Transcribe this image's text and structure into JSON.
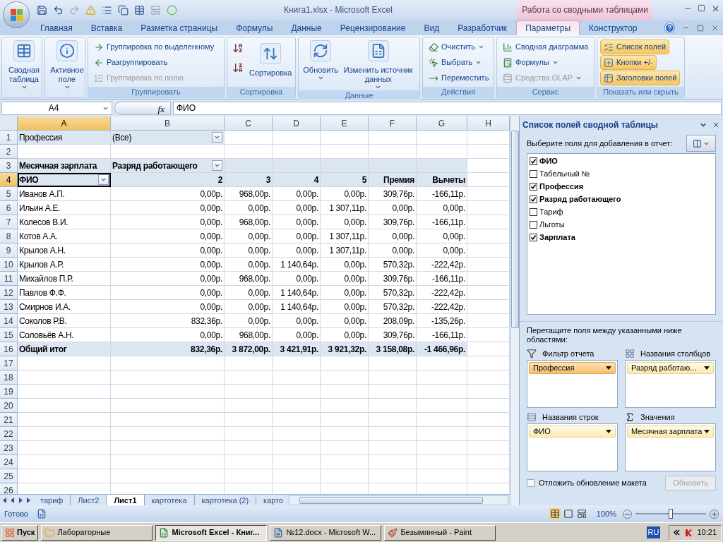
{
  "title_bar": {
    "title": "Книга1.xlsx - Microsoft Excel",
    "context_title": "Работа со сводными таблицами"
  },
  "tabs": [
    {
      "label": "Главная",
      "selected": false
    },
    {
      "label": "Вставка",
      "selected": false
    },
    {
      "label": "Разметка страницы",
      "selected": false
    },
    {
      "label": "Формулы",
      "selected": false
    },
    {
      "label": "Данные",
      "selected": false
    },
    {
      "label": "Рецензирование",
      "selected": false
    },
    {
      "label": "Вид",
      "selected": false
    },
    {
      "label": "Разработчик",
      "selected": false
    },
    {
      "label": "Параметры",
      "selected": true
    },
    {
      "label": "Конструктор",
      "selected": false
    }
  ],
  "ribbon": [
    {
      "items": [
        {
          "kind": "large",
          "label": "Сводная таблица",
          "dropdown": true,
          "disabled": false
        }
      ]
    },
    {
      "items": [
        {
          "kind": "large",
          "label": "Активное поле",
          "dropdown": true,
          "disabled": false
        }
      ]
    },
    {
      "label": "Группировать",
      "items": [
        {
          "kind": "small",
          "label": "Группировка по выделенному",
          "dropdown": false,
          "disabled": false
        },
        {
          "kind": "small",
          "label": "Разгруппировать",
          "dropdown": false,
          "disabled": false
        },
        {
          "kind": "small",
          "label": "Группировка по полю",
          "dropdown": false,
          "disabled": true
        }
      ]
    },
    {
      "label": "Сортировка",
      "items": [
        {
          "kind": "icon"
        },
        {
          "kind": "icon"
        },
        {
          "kind": "large",
          "label": "Сортировка",
          "dropdown": false,
          "disabled": false
        }
      ]
    },
    {
      "label": "Данные",
      "items": [
        {
          "kind": "large",
          "label": "Обновить",
          "dropdown": true,
          "disabled": false
        },
        {
          "kind": "large",
          "label": "Изменить источник данных",
          "dropdown": true,
          "disabled": false
        }
      ]
    },
    {
      "label": "Действия",
      "items": [
        {
          "kind": "small",
          "label": "Очистить",
          "dropdown": true,
          "disabled": false
        },
        {
          "kind": "small",
          "label": "Выбрать",
          "dropdown": true,
          "disabled": false
        },
        {
          "kind": "small",
          "label": "Переместить",
          "dropdown": false,
          "disabled": false
        }
      ]
    },
    {
      "label": "Сервис",
      "items": [
        {
          "kind": "small",
          "label": "Сводная диаграмма",
          "dropdown": false,
          "disabled": false
        },
        {
          "kind": "small",
          "label": "Формулы",
          "dropdown": true,
          "disabled": false
        },
        {
          "kind": "small",
          "label": "Средства OLAP",
          "dropdown": true,
          "disabled": true
        }
      ]
    },
    {
      "label": "Показать или скрыть",
      "items": [
        {
          "kind": "toggle",
          "label": "Список полей",
          "on": true
        },
        {
          "kind": "toggle",
          "label": "Кнопки +/-",
          "on": true
        },
        {
          "kind": "toggle",
          "label": "Заголовки полей",
          "on": true
        }
      ]
    }
  ],
  "formula_bar": {
    "name_box": "A4",
    "fx": "fx",
    "formula": "ФИО"
  },
  "columns": [
    {
      "label": "A",
      "selected": true
    },
    {
      "label": "B",
      "selected": false
    },
    {
      "label": "C",
      "selected": false
    },
    {
      "label": "D",
      "selected": false
    },
    {
      "label": "E",
      "selected": false
    },
    {
      "label": "F",
      "selected": false
    },
    {
      "label": "G",
      "selected": false
    },
    {
      "label": "H",
      "selected": false
    }
  ],
  "row_headers": [
    {
      "label": "1",
      "selected": false
    },
    {
      "label": "2",
      "selected": false
    },
    {
      "label": "3",
      "selected": false
    },
    {
      "label": "4",
      "selected": true
    },
    {
      "label": "5",
      "selected": false
    },
    {
      "label": "6",
      "selected": false
    },
    {
      "label": "7",
      "selected": false
    },
    {
      "label": "8",
      "selected": false
    },
    {
      "label": "9",
      "selected": false
    },
    {
      "label": "10",
      "selected": false
    },
    {
      "label": "11",
      "selected": false
    },
    {
      "label": "12",
      "selected": false
    },
    {
      "label": "13",
      "selected": false
    },
    {
      "label": "14",
      "selected": false
    },
    {
      "label": "15",
      "selected": false
    },
    {
      "label": "16",
      "selected": false
    },
    {
      "label": "17",
      "selected": false
    },
    {
      "label": "18",
      "selected": false
    },
    {
      "label": "19",
      "selected": false
    },
    {
      "label": "20",
      "selected": false
    },
    {
      "label": "21",
      "selected": false
    },
    {
      "label": "22",
      "selected": false
    },
    {
      "label": "23",
      "selected": false
    },
    {
      "label": "24",
      "selected": false
    },
    {
      "label": "25",
      "selected": false
    },
    {
      "label": "26",
      "selected": false
    }
  ],
  "pivot": {
    "filter": {
      "label": "Профессия",
      "value": "(Все)"
    },
    "values_label": "Месячная зарплата",
    "column_field": "Разряд работающего",
    "row_field": "ФИО",
    "column_headers": [
      "2",
      "3",
      "4",
      "5",
      "Премия",
      "Вычеты"
    ],
    "rows": [
      {
        "name": "Иванов А.П.",
        "values": [
          "0,00р.",
          "968,00р.",
          "0,00р.",
          "0,00р.",
          "309,76р.",
          "-166,11р."
        ]
      },
      {
        "name": "Ильин А.Е.",
        "values": [
          "0,00р.",
          "0,00р.",
          "0,00р.",
          "1 307,11р.",
          "0,00р.",
          "0,00р."
        ]
      },
      {
        "name": "Колесов В.И.",
        "values": [
          "0,00р.",
          "968,00р.",
          "0,00р.",
          "0,00р.",
          "309,76р.",
          "-166,11р."
        ]
      },
      {
        "name": "Котов А.А.",
        "values": [
          "0,00р.",
          "0,00р.",
          "0,00р.",
          "1 307,11р.",
          "0,00р.",
          "0,00р."
        ]
      },
      {
        "name": "Крылов А.Н.",
        "values": [
          "0,00р.",
          "0,00р.",
          "0,00р.",
          "1 307,11р.",
          "0,00р.",
          "0,00р."
        ]
      },
      {
        "name": "Крылов А.Р.",
        "values": [
          "0,00р.",
          "0,00р.",
          "1 140,64р.",
          "0,00р.",
          "570,32р.",
          "-222,42р."
        ]
      },
      {
        "name": "Михайлов П.Р.",
        "values": [
          "0,00р.",
          "968,00р.",
          "0,00р.",
          "0,00р.",
          "309,76р.",
          "-166,11р."
        ]
      },
      {
        "name": "Павлов Ф.Ф.",
        "values": [
          "0,00р.",
          "0,00р.",
          "1 140,64р.",
          "0,00р.",
          "570,32р.",
          "-222,42р."
        ]
      },
      {
        "name": "Смирнов И.А.",
        "values": [
          "0,00р.",
          "0,00р.",
          "1 140,64р.",
          "0,00р.",
          "570,32р.",
          "-222,42р."
        ]
      },
      {
        "name": "Соколов Р.В.",
        "values": [
          "832,36р.",
          "0,00р.",
          "0,00р.",
          "0,00р.",
          "208,09р.",
          "-135,26р."
        ]
      },
      {
        "name": "Соловьёв А.Н.",
        "values": [
          "0,00р.",
          "968,00р.",
          "0,00р.",
          "0,00р.",
          "309,76р.",
          "-166,11р."
        ]
      }
    ],
    "total": {
      "label": "Общий итог",
      "values": [
        "832,36р.",
        "3 872,00р.",
        "3 421,91р.",
        "3 921,32р.",
        "3 158,08р.",
        "-1 466,96р."
      ]
    }
  },
  "sheet_tabs": [
    {
      "label": "тариф",
      "selected": false
    },
    {
      "label": "Лист2",
      "selected": false
    },
    {
      "label": "Лист1",
      "selected": true
    },
    {
      "label": "картотека",
      "selected": false
    },
    {
      "label": "картотека (2)",
      "selected": false
    },
    {
      "label": "карто",
      "selected": false
    }
  ],
  "field_list": {
    "title": "Список полей сводной таблицы",
    "prompt": "Выберите поля для добавления в отчет:",
    "fields": [
      {
        "label": "ФИО",
        "checked": true
      },
      {
        "label": "Табельный №",
        "checked": false
      },
      {
        "label": "Профессия",
        "checked": true
      },
      {
        "label": "Разряд работающего",
        "checked": true
      },
      {
        "label": "Тариф",
        "checked": false
      },
      {
        "label": "Льготы",
        "checked": false
      },
      {
        "label": "Зарплата",
        "checked": true
      }
    ],
    "drag_prompt": "Перетащите поля между указанными ниже областями:",
    "areas": [
      {
        "kind": "filter",
        "title": "Фильтр отчета",
        "items": [
          {
            "label": "Профессия",
            "selected": true
          }
        ]
      },
      {
        "kind": "columns",
        "title": "Названия столбцов",
        "items": [
          {
            "label": "Разряд работаю...",
            "selected": false
          }
        ]
      },
      {
        "kind": "rows",
        "title": "Названия строк",
        "items": [
          {
            "label": "ФИО",
            "selected": false
          }
        ]
      },
      {
        "kind": "values",
        "title": "Значения",
        "items": [
          {
            "label": "Месячная зарплата",
            "selected": false
          }
        ]
      }
    ],
    "defer": {
      "label": "Отложить обновление макета",
      "checked": false
    },
    "update_button": {
      "label": "Обновить",
      "disabled": true
    }
  },
  "status_bar": {
    "status": "Готово",
    "zoom": "100%",
    "zoom_slider": {
      "level": 0.5
    }
  },
  "taskbar": {
    "start": "Пуск",
    "tasks": [
      {
        "label": "Лабораторные",
        "selected": false
      },
      {
        "label": "Microsoft Excel - Книг...",
        "selected": true
      },
      {
        "label": "№12.docx - Microsoft W...",
        "selected": false
      },
      {
        "label": "Безымянный - Paint",
        "selected": false
      }
    ],
    "language": "RU",
    "clock": "10:21"
  }
}
